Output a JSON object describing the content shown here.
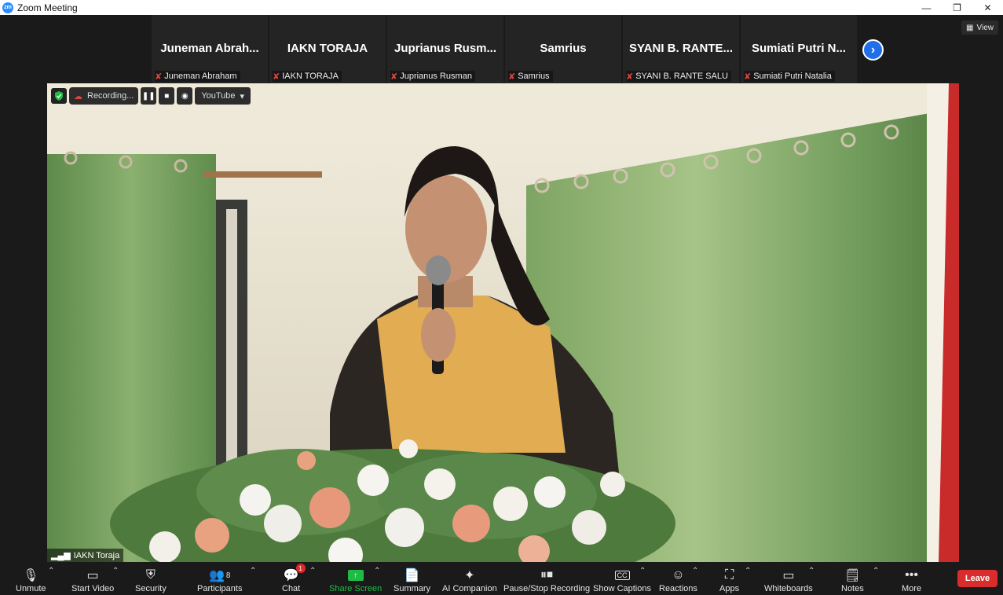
{
  "window": {
    "title": "Zoom Meeting",
    "logo_text": "zm"
  },
  "top_right": {
    "view_label": "View"
  },
  "gallery": [
    {
      "display": "Juneman  Abrah...",
      "name": "Juneman Abraham"
    },
    {
      "display": "IAKN TORAJA",
      "name": "IAKN TORAJA"
    },
    {
      "display": "Juprianus Rusm...",
      "name": "Juprianus Rusman"
    },
    {
      "display": "Samrius",
      "name": "Samrius"
    },
    {
      "display": "SYANI B. RANTE...",
      "name": "SYANI B. RANTE SALU"
    },
    {
      "display": "Sumiati Putri N...",
      "name": "Sumiati Putri Natalia"
    }
  ],
  "recording": {
    "status": "Recording...",
    "stream": "YouTube"
  },
  "active_speaker": {
    "name": "IAKN Toraja"
  },
  "toolbar": {
    "unmute": "Unmute",
    "start_video": "Start Video",
    "security": "Security",
    "participants": "Participants",
    "participants_count": "8",
    "chat": "Chat",
    "chat_badge": "1",
    "share_screen": "Share Screen",
    "summary": "Summary",
    "ai_companion": "AI Companion",
    "pause_stop_recording": "Pause/Stop Recording",
    "show_captions": "Show Captions",
    "reactions": "Reactions",
    "apps": "Apps",
    "whiteboards": "Whiteboards",
    "notes": "Notes",
    "more": "More",
    "leave": "Leave"
  },
  "colors": {
    "accent": "#2d8cff",
    "share_green": "#1fbc45",
    "leave_red": "#d92c2c",
    "muted_red": "#e0453b",
    "curtain_green": "#6f9a5a"
  }
}
